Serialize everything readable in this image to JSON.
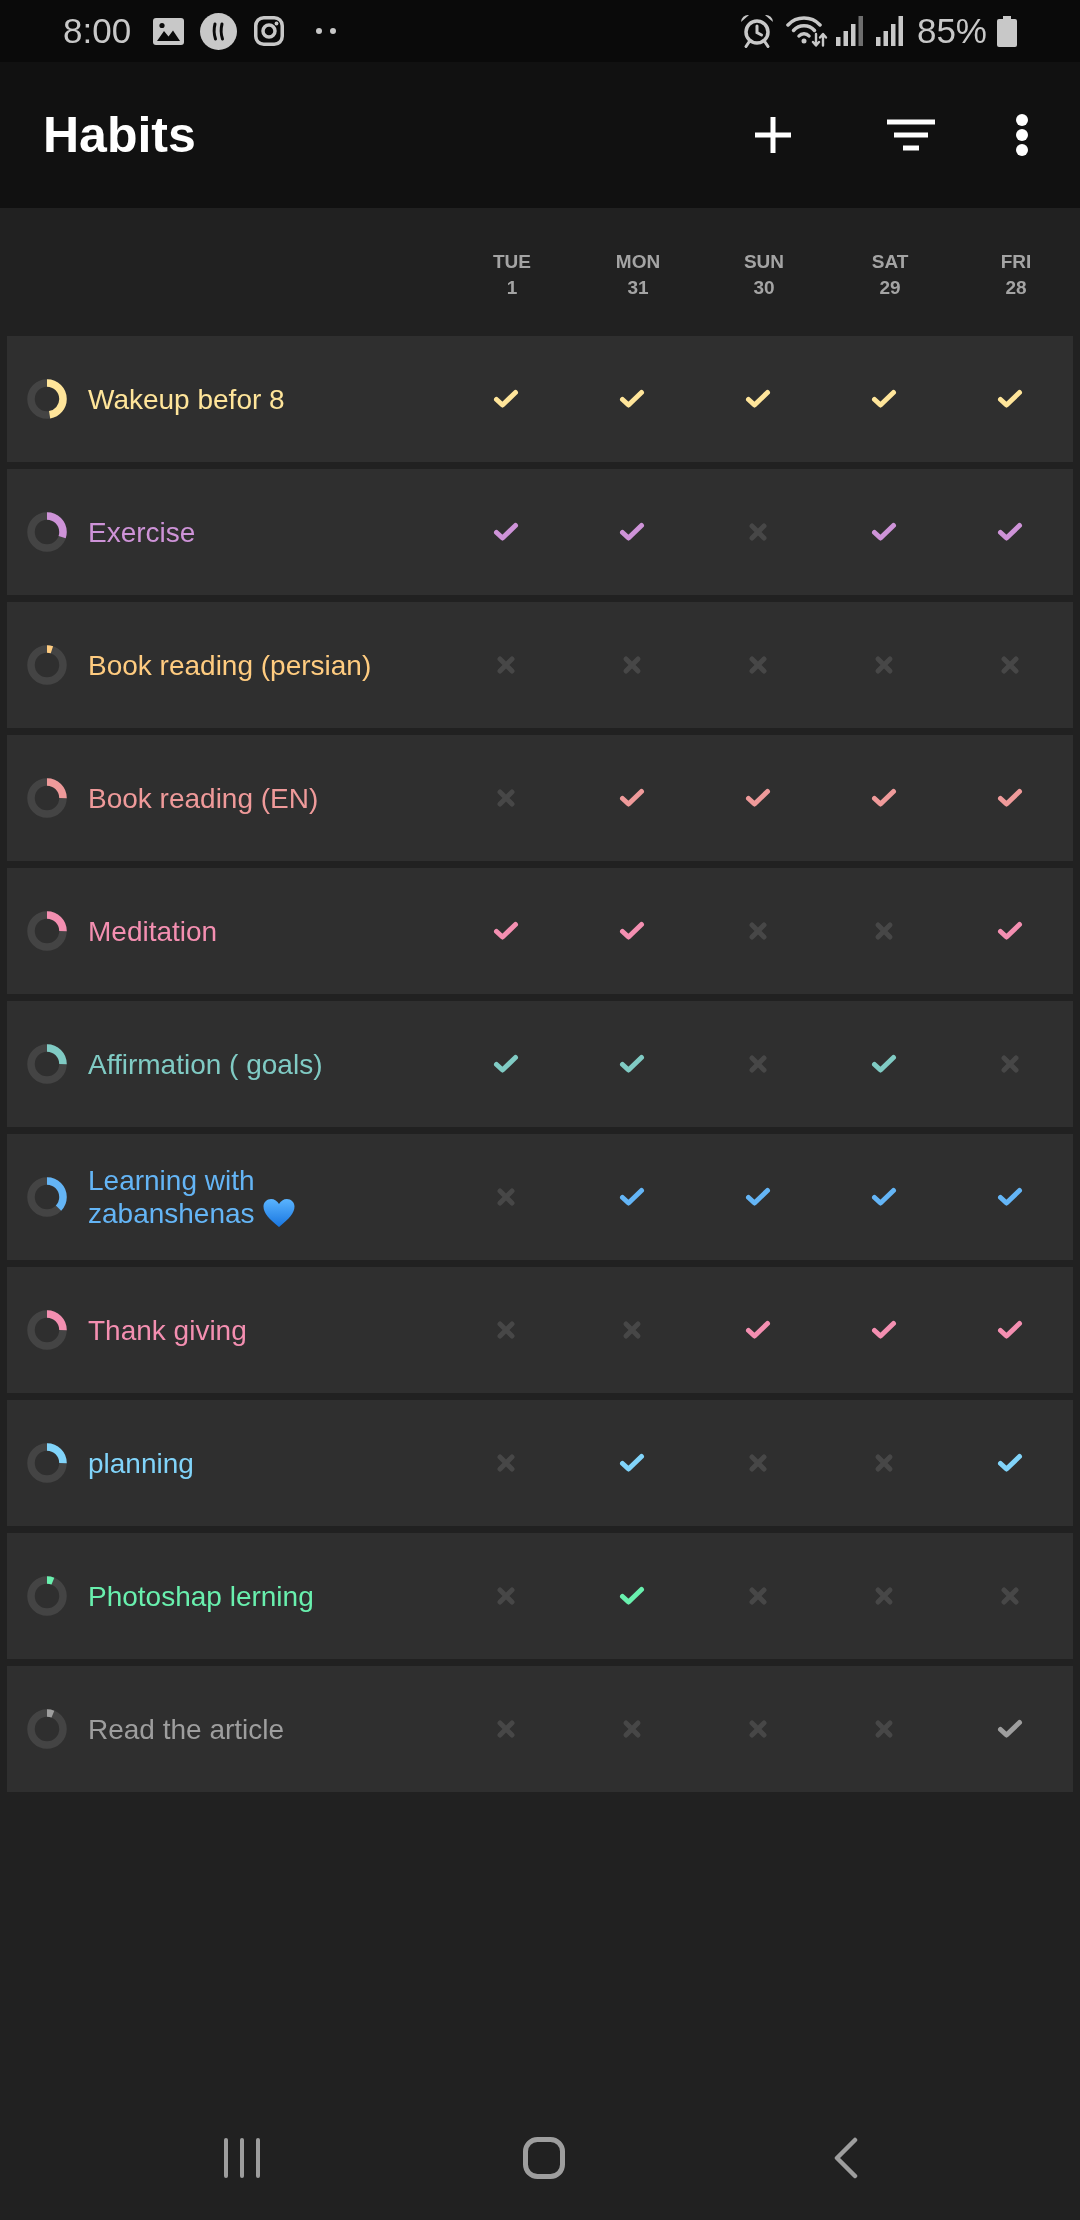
{
  "status_bar": {
    "time": "8:00",
    "battery": "85%"
  },
  "app_bar": {
    "title": "Habits"
  },
  "days": [
    {
      "weekday": "TUE",
      "date": "1"
    },
    {
      "weekday": "MON",
      "date": "31"
    },
    {
      "weekday": "SUN",
      "date": "30"
    },
    {
      "weekday": "SAT",
      "date": "29"
    },
    {
      "weekday": "FRI",
      "date": "28"
    }
  ],
  "habits": [
    {
      "kind": "plain",
      "name": "Wakeup befor 8",
      "color": "#ffe59a",
      "level": 0.47,
      "checks": [
        {
          "checked": true
        },
        {
          "checked": true
        },
        {
          "checked": true
        },
        {
          "checked": true
        },
        {
          "checked": true
        }
      ]
    },
    {
      "kind": "plain",
      "name": "Exercise",
      "color": "#ce93d8",
      "level": 0.3,
      "checks": [
        {
          "checked": true
        },
        {
          "checked": true
        },
        {
          "checked": false
        },
        {
          "checked": true
        },
        {
          "checked": true
        }
      ]
    },
    {
      "kind": "plain",
      "name": "Book reading (persian)",
      "color": "#ffcc80",
      "level": 0.05,
      "checks": [
        {
          "checked": false
        },
        {
          "checked": false
        },
        {
          "checked": false
        },
        {
          "checked": false
        },
        {
          "checked": false
        }
      ]
    },
    {
      "kind": "plain",
      "name": "Book reading (EN)",
      "color": "#ef9a9a",
      "level": 0.25,
      "checks": [
        {
          "checked": false
        },
        {
          "checked": true
        },
        {
          "checked": true
        },
        {
          "checked": true
        },
        {
          "checked": true
        }
      ]
    },
    {
      "kind": "plain",
      "name": "Meditation",
      "color": "#f48fb1",
      "level": 0.25,
      "checks": [
        {
          "checked": true
        },
        {
          "checked": true
        },
        {
          "checked": false
        },
        {
          "checked": false
        },
        {
          "checked": true
        }
      ]
    },
    {
      "kind": "plain",
      "name": "Affirmation ( goals)",
      "color": "#80cbc4",
      "level": 0.25,
      "checks": [
        {
          "checked": true
        },
        {
          "checked": true
        },
        {
          "checked": false
        },
        {
          "checked": true
        },
        {
          "checked": false
        }
      ]
    },
    {
      "kind": "heart",
      "name": "Learning with zabanshenas",
      "color": "#64b5f6",
      "level": 0.37,
      "checks": [
        {
          "checked": false
        },
        {
          "checked": true
        },
        {
          "checked": true
        },
        {
          "checked": true
        },
        {
          "checked": true
        }
      ]
    },
    {
      "kind": "plain",
      "name": "Thank giving",
      "color": "#f48fb1",
      "level": 0.25,
      "checks": [
        {
          "checked": false
        },
        {
          "checked": false
        },
        {
          "checked": true
        },
        {
          "checked": true
        },
        {
          "checked": true
        }
      ]
    },
    {
      "kind": "plain",
      "name": "planning",
      "color": "#81d4fa",
      "level": 0.25,
      "checks": [
        {
          "checked": false
        },
        {
          "checked": true
        },
        {
          "checked": false
        },
        {
          "checked": false
        },
        {
          "checked": true
        }
      ]
    },
    {
      "kind": "plain",
      "name": "Photoshap lerning",
      "color": "#69f0ae",
      "level": 0.06,
      "checks": [
        {
          "checked": false
        },
        {
          "checked": true
        },
        {
          "checked": false
        },
        {
          "checked": false
        },
        {
          "checked": false
        }
      ]
    },
    {
      "kind": "plain",
      "name": "Read the article",
      "color": "#9e9e9e",
      "level": 0.06,
      "checks": [
        {
          "checked": false
        },
        {
          "checked": false
        },
        {
          "checked": false
        },
        {
          "checked": false
        },
        {
          "checked": true
        }
      ]
    }
  ]
}
